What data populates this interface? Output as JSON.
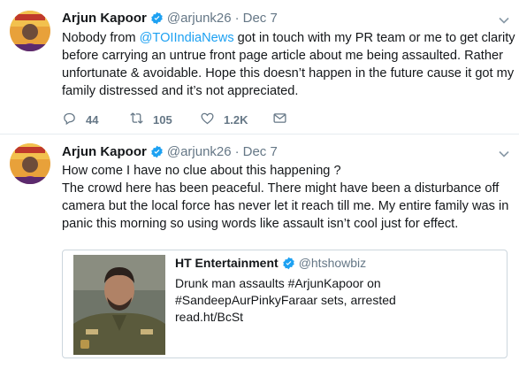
{
  "tweets": [
    {
      "author_name": "Arjun Kapoor",
      "handle": "@arjunk26",
      "separator": "·",
      "date": "Dec 7",
      "avatar_icon": "profile-photo",
      "text_lines": [
        {
          "before": "Nobody from ",
          "mention": "@TOIIndiaNews",
          "after": " got in touch with my PR team or me to get clarity"
        },
        "before carrying an untrue front page article about me being assaulted. Rather",
        "unfortunate & avoidable. Hope this doesn’t happen in the future cause it got my",
        "family distressed and it’s not appreciated."
      ],
      "actions": {
        "replies": "44",
        "retweets": "105",
        "likes": "1.2K"
      }
    },
    {
      "author_name": "Arjun Kapoor",
      "handle": "@arjunk26",
      "separator": "·",
      "date": "Dec 7",
      "avatar_icon": "profile-photo",
      "text_lines": [
        "How come I have no clue about this happening ?",
        "The crowd here has been peaceful. There might have been a disturbance off",
        "camera but the local force has never let it reach till me. My entire family was in",
        "panic this morning so using words like assault isn’t cool just for effect."
      ],
      "quoted": {
        "author_name": "HT Entertainment",
        "handle": "@htshowbiz",
        "image_icon": "man-in-police-uniform-photo",
        "text_lines": [
          "Drunk man assaults #ArjunKapoor on",
          "#SandeepAurPinkyFaraar sets, arrested",
          "read.ht/BcSt"
        ]
      }
    }
  ],
  "colors": {
    "accent": "#1da1f2",
    "muted": "#657786",
    "text": "#14171a",
    "border": "#e6ecf0"
  }
}
